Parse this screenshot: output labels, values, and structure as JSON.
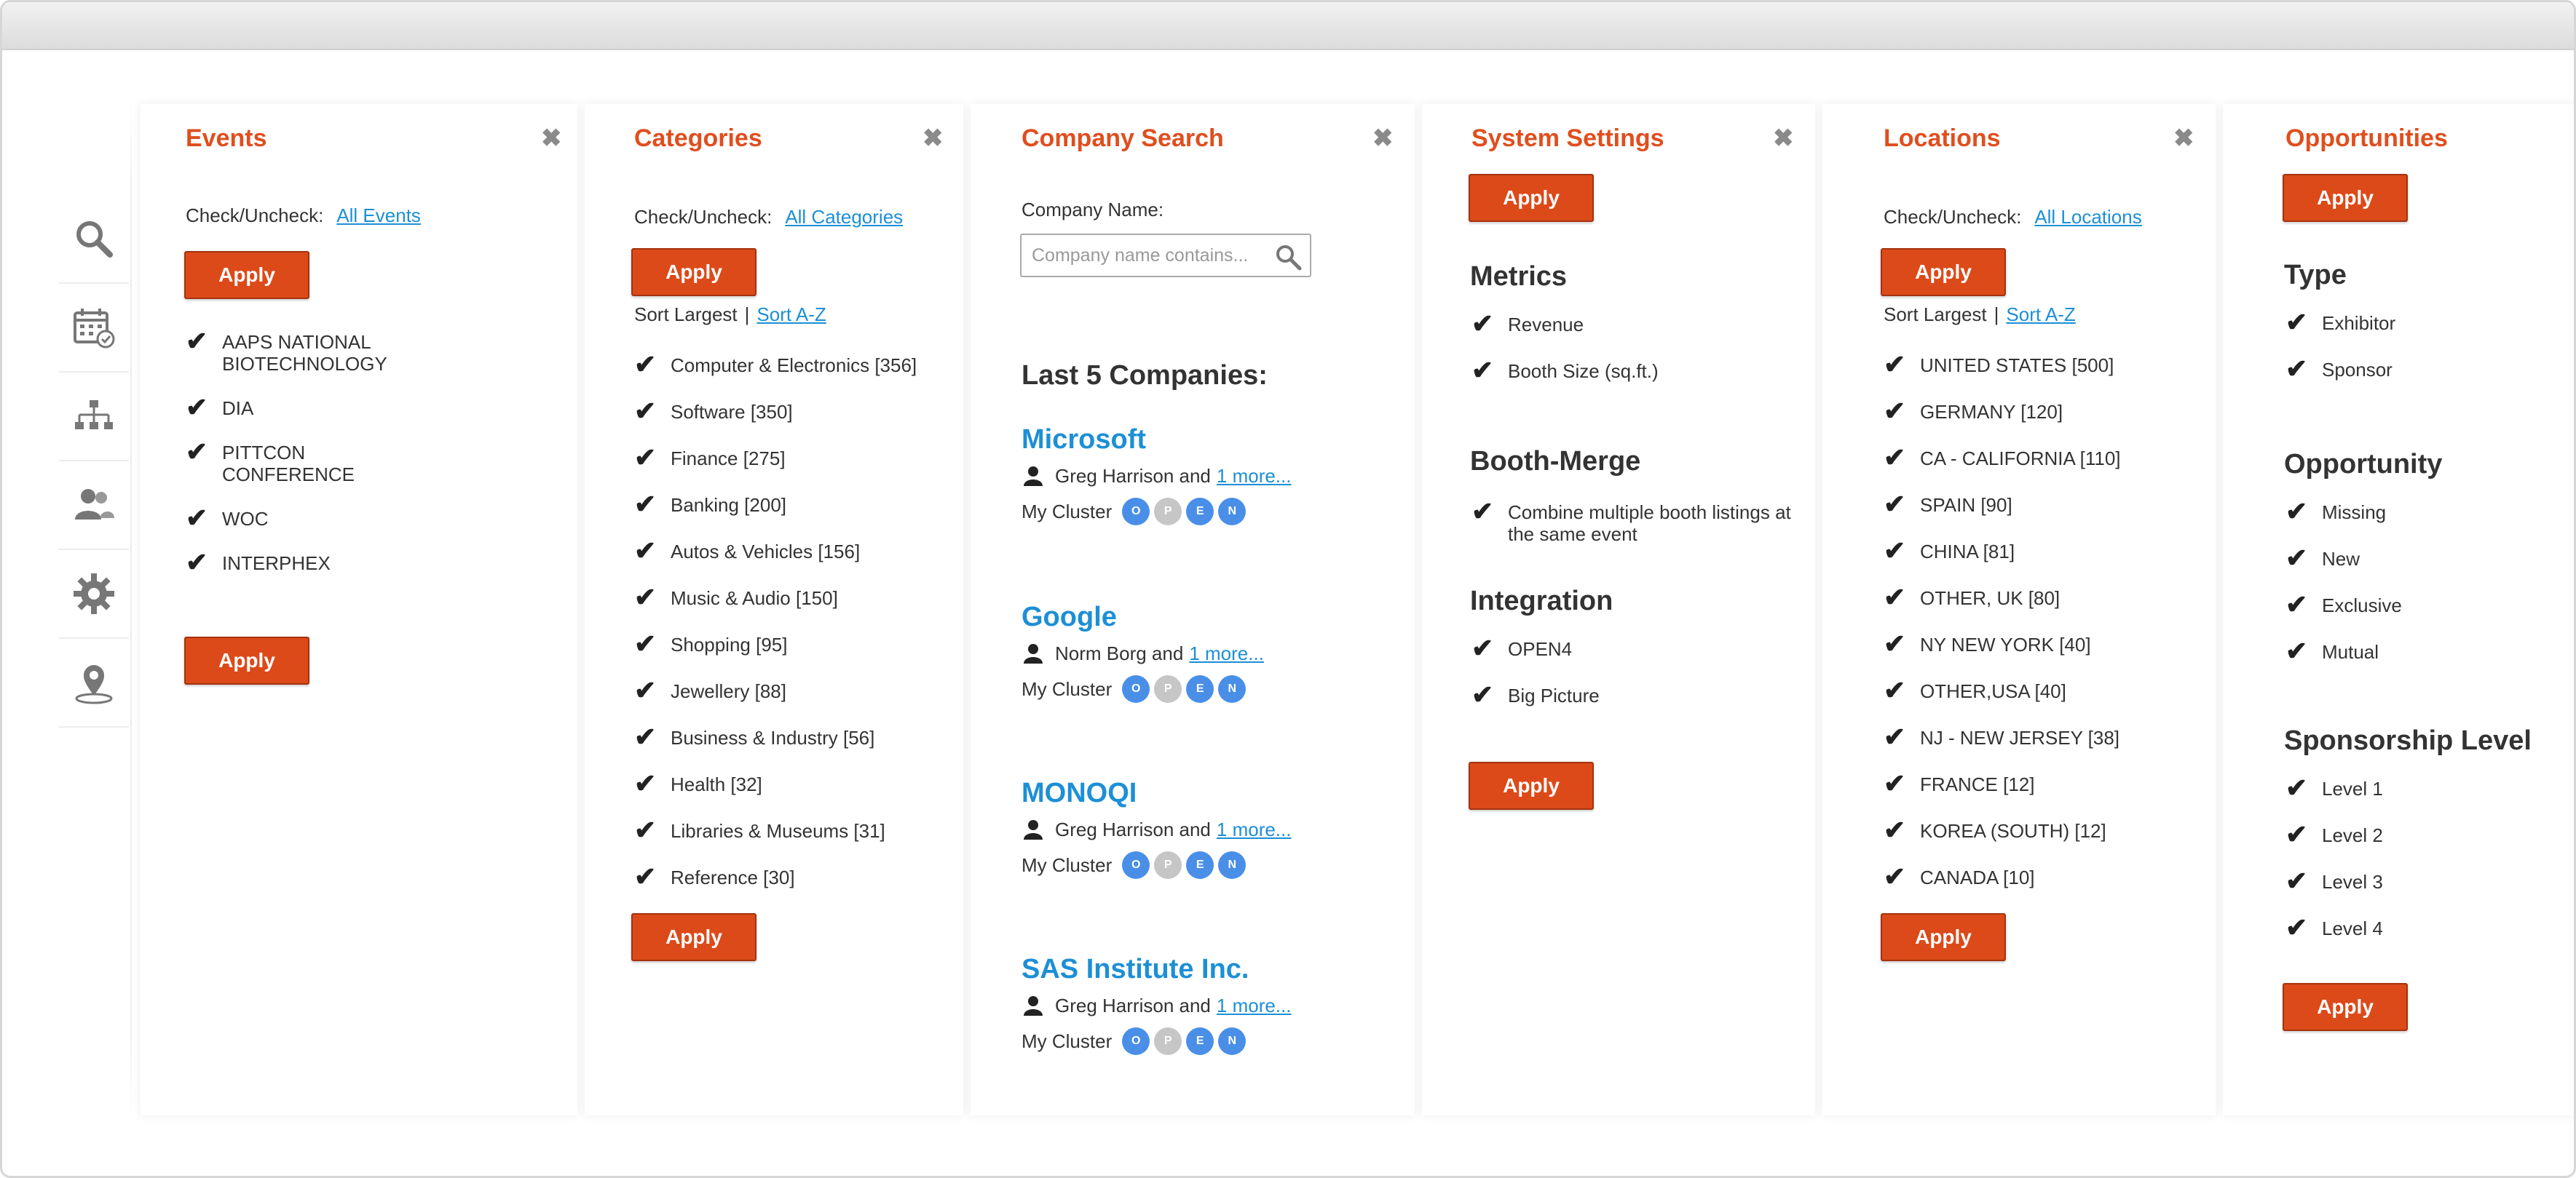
{
  "colors": {
    "accent": "#e04e1e",
    "button": "#dc4a19",
    "link": "#1c8fd6",
    "cluster_blue": "#4a8fe7",
    "cluster_gray": "#c6c6c6"
  },
  "nav": {
    "icons": [
      "search-icon",
      "calendar-check-icon",
      "org-chart-icon",
      "users-icon",
      "gear-icon",
      "location-pin-icon"
    ]
  },
  "events": {
    "title": "Events",
    "check_label": "Check/Uncheck:",
    "check_link": "All Events",
    "apply": "Apply",
    "items": [
      {
        "label": "AAPS NATIONAL BIOTECHNOLOGY",
        "checked": true
      },
      {
        "label": "DIA",
        "checked": true
      },
      {
        "label": "PITTCON CONFERENCE",
        "checked": true
      },
      {
        "label": "WOC",
        "checked": true
      },
      {
        "label": "INTERPHEX",
        "checked": true
      }
    ]
  },
  "categories": {
    "title": "Categories",
    "check_label": "Check/Uncheck:",
    "check_link": "All Categories",
    "apply": "Apply",
    "sort_current": "Sort Largest",
    "sort_sep": "|",
    "sort_link": "Sort A-Z",
    "items": [
      {
        "label": "Computer & Electronics [356]",
        "checked": true
      },
      {
        "label": "Software [350]",
        "checked": true
      },
      {
        "label": "Finance [275]",
        "checked": true
      },
      {
        "label": "Banking [200]",
        "checked": true
      },
      {
        "label": "Autos & Vehicles [156]",
        "checked": true
      },
      {
        "label": "Music & Audio [150]",
        "checked": true
      },
      {
        "label": "Shopping [95]",
        "checked": true
      },
      {
        "label": "Jewellery [88]",
        "checked": true
      },
      {
        "label": "Business & Industry [56]",
        "checked": true
      },
      {
        "label": "Health [32]",
        "checked": true
      },
      {
        "label": "Libraries & Museums [31]",
        "checked": true
      },
      {
        "label": "Reference [30]",
        "checked": true
      }
    ]
  },
  "company_search": {
    "title": "Company Search",
    "field_label": "Company Name:",
    "placeholder": "Company name contains...",
    "last_heading": "Last 5 Companies:",
    "cluster_label": "My Cluster",
    "cluster_letters": [
      "O",
      "P",
      "E",
      "N"
    ],
    "companies": [
      {
        "name": "Microsoft",
        "person": "Greg Harrison and",
        "more": "1 more...",
        "cluster_active": [
          true,
          false,
          true,
          true
        ]
      },
      {
        "name": "Google",
        "person": "Norm Borg and",
        "more": "1 more...",
        "cluster_active": [
          true,
          false,
          true,
          true
        ]
      },
      {
        "name": "MONOQI",
        "person": "Greg Harrison and",
        "more": "1 more...",
        "cluster_active": [
          true,
          false,
          true,
          true
        ]
      },
      {
        "name": "SAS Institute Inc.",
        "person": "Greg Harrison and",
        "more": "1 more...",
        "cluster_active": [
          true,
          false,
          true,
          true
        ]
      }
    ]
  },
  "system_settings": {
    "title": "System Settings",
    "apply": "Apply",
    "metrics_heading": "Metrics",
    "metrics": [
      {
        "label": "Revenue",
        "checked": true
      },
      {
        "label": "Booth Size (sq.ft.)",
        "checked": true
      }
    ],
    "merge_heading": "Booth-Merge",
    "merge": [
      {
        "label": "Combine multiple booth listings at the same event",
        "checked": true
      }
    ],
    "integration_heading": "Integration",
    "integration": [
      {
        "label": "OPEN4",
        "checked": true
      },
      {
        "label": "Big Picture",
        "checked": true
      }
    ]
  },
  "locations": {
    "title": "Locations",
    "check_label": "Check/Uncheck:",
    "check_link": "All Locations",
    "apply": "Apply",
    "sort_current": "Sort Largest",
    "sort_sep": "|",
    "sort_link": "Sort A-Z",
    "items": [
      {
        "label": "UNITED STATES [500]",
        "checked": true
      },
      {
        "label": "GERMANY [120]",
        "checked": true
      },
      {
        "label": "CA - CALIFORNIA [110]",
        "checked": true
      },
      {
        "label": "SPAIN [90]",
        "checked": true
      },
      {
        "label": "CHINA [81]",
        "checked": true
      },
      {
        "label": "OTHER, UK [80]",
        "checked": true
      },
      {
        "label": "NY NEW YORK [40]",
        "checked": true
      },
      {
        "label": "OTHER,USA [40]",
        "checked": true
      },
      {
        "label": "NJ - NEW JERSEY [38]",
        "checked": true
      },
      {
        "label": "FRANCE [12]",
        "checked": true
      },
      {
        "label": "KOREA (SOUTH) [12]",
        "checked": true
      },
      {
        "label": "CANADA [10]",
        "checked": true
      }
    ]
  },
  "opportunities": {
    "title": "Opportunities",
    "apply": "Apply",
    "type_heading": "Type",
    "type": [
      {
        "label": "Exhibitor",
        "checked": true
      },
      {
        "label": "Sponsor",
        "checked": true
      }
    ],
    "opp_heading": "Opportunity",
    "opportunity": [
      {
        "label": "Missing",
        "checked": true
      },
      {
        "label": "New",
        "checked": true
      },
      {
        "label": "Exclusive",
        "checked": true
      },
      {
        "label": "Mutual",
        "checked": true
      }
    ],
    "level_heading": "Sponsorship Level",
    "levels": [
      {
        "label": "Level 1",
        "checked": true
      },
      {
        "label": "Level 2",
        "checked": true
      },
      {
        "label": "Level 3",
        "checked": true
      },
      {
        "label": "Level 4",
        "checked": true
      }
    ]
  }
}
